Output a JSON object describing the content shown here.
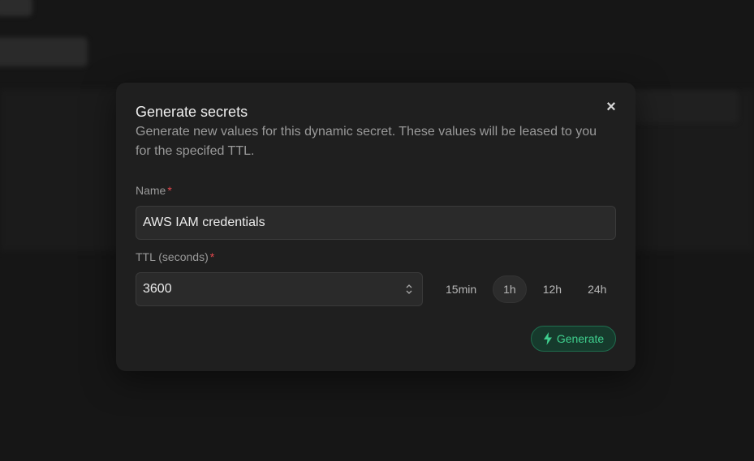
{
  "modal": {
    "title": "Generate secrets",
    "subtitle": "Generate new values for this dynamic secret. These values will be leased to you for the specifed TTL.",
    "close_icon": "close-icon"
  },
  "form": {
    "name": {
      "label": "Name",
      "required_mark": "*",
      "value": "AWS IAM credentials"
    },
    "ttl": {
      "label": "TTL (seconds)",
      "required_mark": "*",
      "value": "3600"
    },
    "presets": [
      {
        "label": "15min",
        "active": false
      },
      {
        "label": "1h",
        "active": true
      },
      {
        "label": "12h",
        "active": false
      },
      {
        "label": "24h",
        "active": false
      }
    ]
  },
  "actions": {
    "generate_label": "Generate",
    "generate_icon": "bolt-icon"
  },
  "colors": {
    "accent": "#3fcf8e",
    "required": "#e5484d",
    "modal_bg": "#1f1f1f"
  }
}
